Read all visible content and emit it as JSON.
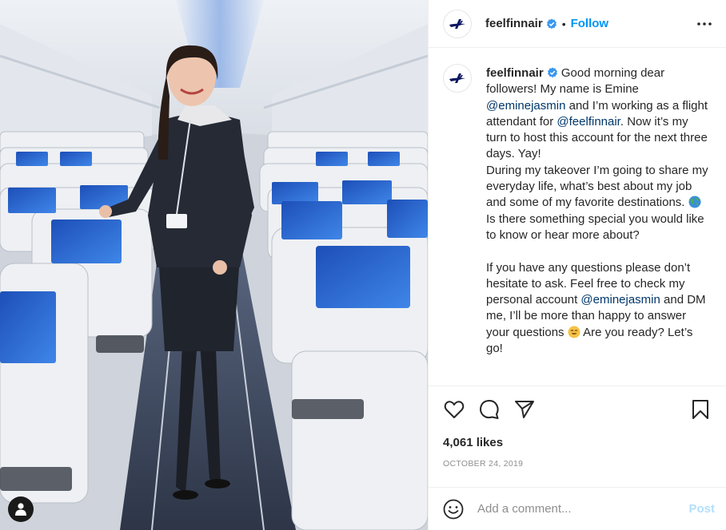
{
  "account": {
    "username": "feelfinnair",
    "verified": true,
    "follow_label": "Follow",
    "separator": "•"
  },
  "caption": {
    "username": "feelfinnair",
    "parts": [
      {
        "t": "text",
        "v": " Good morning dear followers! My name is Emine "
      },
      {
        "t": "mention",
        "v": "@eminejasmin"
      },
      {
        "t": "text",
        "v": " and I’m working as a flight attendant for "
      },
      {
        "t": "mention",
        "v": "@feelfinnair"
      },
      {
        "t": "text",
        "v": ". Now it’s my turn to host this account for the next three days. Yay!\nDuring my takeover I’m going to share my everyday life, what’s best about my job and some of my favorite destinations. "
      },
      {
        "t": "emoji",
        "v": "globe-emoji"
      },
      {
        "t": "text",
        "v": " Is there something special you would like to know or hear more about?\n\nIf you have any questions please don’t hesitate to ask. Feel free to check my personal account "
      },
      {
        "t": "mention",
        "v": "@eminejasmin"
      },
      {
        "t": "text",
        "v": " and DM me, I’ll be more than happy to answer your questions "
      },
      {
        "t": "emoji",
        "v": "smiling-face-emoji"
      },
      {
        "t": "text",
        "v": " Are you ready? Let’s go!"
      }
    ]
  },
  "actions": {
    "like": "heart-icon",
    "comment": "comment-bubble-icon",
    "share": "paper-plane-icon",
    "save": "bookmark-icon"
  },
  "likes_text": "4,061 likes",
  "date_text": "OCTOBER 24, 2019",
  "comment": {
    "placeholder": "Add a comment...",
    "post_label": "Post"
  },
  "colors": {
    "accent": "#0095f6",
    "mention": "#00376b",
    "post_disabled": "#b2dffc",
    "brand_logo": "#0b1560"
  }
}
